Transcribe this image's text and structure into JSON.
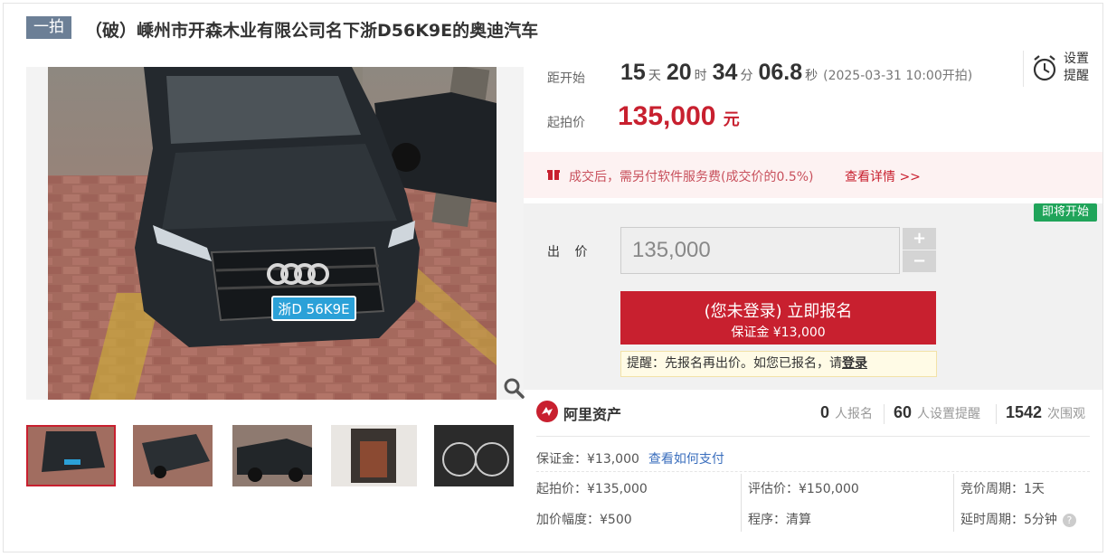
{
  "header": {
    "badge": "一拍",
    "title": "（破）嵊州市开森木业有限公司名下浙D56K9E的奥迪汽车"
  },
  "gallery": {
    "plate_text": "浙D 56K9E",
    "zoom_icon": "magnifier-icon",
    "thumbnail_count": 5
  },
  "countdown": {
    "label": "距开始",
    "days": "15",
    "days_unit": "天",
    "hours": "20",
    "hours_unit": "时",
    "minutes": "34",
    "minutes_unit": "分",
    "seconds": "06.8",
    "seconds_unit": "秒",
    "start_time": "(2025-03-31 10:00开拍)"
  },
  "reminder": {
    "label_line1": "设置",
    "label_line2": "提醒",
    "icon": "alarm-clock-icon"
  },
  "start_price": {
    "label": "起拍价",
    "value": "135,000",
    "unit": "元"
  },
  "fee_notice": {
    "text": "成交后，需另付软件服务费(成交价的0.5%)",
    "link": "查看详情 >>",
    "icon": "gift-icon"
  },
  "bid": {
    "status_badge": "即将开始",
    "label": "出 价",
    "value": "135,000",
    "plus": "+",
    "minus": "−",
    "signup_line1": "(您未登录) 立即报名",
    "signup_line2": "保证金 ¥13,000",
    "tip_text": "提醒：先报名再出价。如您已报名，请",
    "tip_link": "登录"
  },
  "platform": {
    "name": "阿里资产",
    "logo_icon": "ali-asset-logo-icon"
  },
  "stats": {
    "signups": "0",
    "signups_label": "人报名",
    "reminders": "60",
    "reminders_label": "人设置提醒",
    "views": "1542",
    "views_label": "次围观"
  },
  "details": {
    "deposit": "保证金：¥13,000",
    "deposit_link": "查看如何支付",
    "start_price": "起拍价：¥135,000",
    "appraisal": "评估价：¥150,000",
    "cycle": "竞价周期：1天",
    "increment": "加价幅度：¥500",
    "procedure": "程序：清算",
    "delay": "延时周期：5分钟"
  },
  "colors": {
    "accent": "#c8202f",
    "badge": "#6c7f96",
    "soon": "#20a45a",
    "link": "#3a6ebd"
  }
}
